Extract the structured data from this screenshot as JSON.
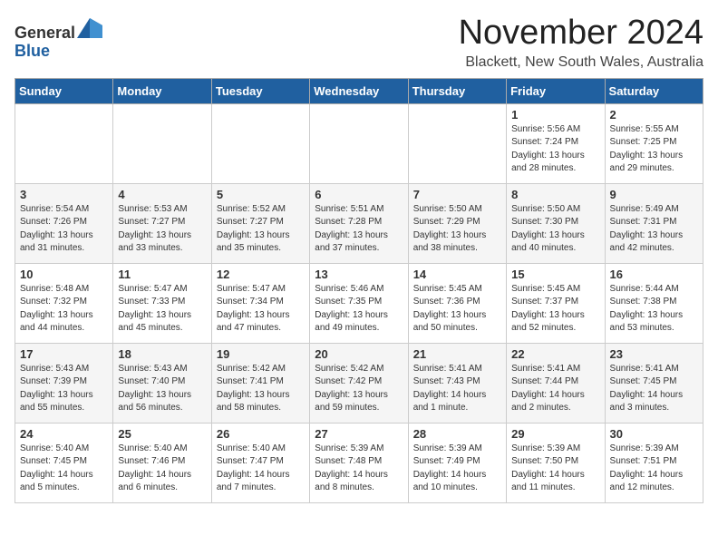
{
  "header": {
    "logo": {
      "general": "General",
      "blue": "Blue"
    },
    "title": "November 2024",
    "location": "Blackett, New South Wales, Australia"
  },
  "calendar": {
    "days_of_week": [
      "Sunday",
      "Monday",
      "Tuesday",
      "Wednesday",
      "Thursday",
      "Friday",
      "Saturday"
    ],
    "weeks": [
      [
        {
          "day": "",
          "info": ""
        },
        {
          "day": "",
          "info": ""
        },
        {
          "day": "",
          "info": ""
        },
        {
          "day": "",
          "info": ""
        },
        {
          "day": "",
          "info": ""
        },
        {
          "day": "1",
          "info": "Sunrise: 5:56 AM\nSunset: 7:24 PM\nDaylight: 13 hours\nand 28 minutes."
        },
        {
          "day": "2",
          "info": "Sunrise: 5:55 AM\nSunset: 7:25 PM\nDaylight: 13 hours\nand 29 minutes."
        }
      ],
      [
        {
          "day": "3",
          "info": "Sunrise: 5:54 AM\nSunset: 7:26 PM\nDaylight: 13 hours\nand 31 minutes."
        },
        {
          "day": "4",
          "info": "Sunrise: 5:53 AM\nSunset: 7:27 PM\nDaylight: 13 hours\nand 33 minutes."
        },
        {
          "day": "5",
          "info": "Sunrise: 5:52 AM\nSunset: 7:27 PM\nDaylight: 13 hours\nand 35 minutes."
        },
        {
          "day": "6",
          "info": "Sunrise: 5:51 AM\nSunset: 7:28 PM\nDaylight: 13 hours\nand 37 minutes."
        },
        {
          "day": "7",
          "info": "Sunrise: 5:50 AM\nSunset: 7:29 PM\nDaylight: 13 hours\nand 38 minutes."
        },
        {
          "day": "8",
          "info": "Sunrise: 5:50 AM\nSunset: 7:30 PM\nDaylight: 13 hours\nand 40 minutes."
        },
        {
          "day": "9",
          "info": "Sunrise: 5:49 AM\nSunset: 7:31 PM\nDaylight: 13 hours\nand 42 minutes."
        }
      ],
      [
        {
          "day": "10",
          "info": "Sunrise: 5:48 AM\nSunset: 7:32 PM\nDaylight: 13 hours\nand 44 minutes."
        },
        {
          "day": "11",
          "info": "Sunrise: 5:47 AM\nSunset: 7:33 PM\nDaylight: 13 hours\nand 45 minutes."
        },
        {
          "day": "12",
          "info": "Sunrise: 5:47 AM\nSunset: 7:34 PM\nDaylight: 13 hours\nand 47 minutes."
        },
        {
          "day": "13",
          "info": "Sunrise: 5:46 AM\nSunset: 7:35 PM\nDaylight: 13 hours\nand 49 minutes."
        },
        {
          "day": "14",
          "info": "Sunrise: 5:45 AM\nSunset: 7:36 PM\nDaylight: 13 hours\nand 50 minutes."
        },
        {
          "day": "15",
          "info": "Sunrise: 5:45 AM\nSunset: 7:37 PM\nDaylight: 13 hours\nand 52 minutes."
        },
        {
          "day": "16",
          "info": "Sunrise: 5:44 AM\nSunset: 7:38 PM\nDaylight: 13 hours\nand 53 minutes."
        }
      ],
      [
        {
          "day": "17",
          "info": "Sunrise: 5:43 AM\nSunset: 7:39 PM\nDaylight: 13 hours\nand 55 minutes."
        },
        {
          "day": "18",
          "info": "Sunrise: 5:43 AM\nSunset: 7:40 PM\nDaylight: 13 hours\nand 56 minutes."
        },
        {
          "day": "19",
          "info": "Sunrise: 5:42 AM\nSunset: 7:41 PM\nDaylight: 13 hours\nand 58 minutes."
        },
        {
          "day": "20",
          "info": "Sunrise: 5:42 AM\nSunset: 7:42 PM\nDaylight: 13 hours\nand 59 minutes."
        },
        {
          "day": "21",
          "info": "Sunrise: 5:41 AM\nSunset: 7:43 PM\nDaylight: 14 hours\nand 1 minute."
        },
        {
          "day": "22",
          "info": "Sunrise: 5:41 AM\nSunset: 7:44 PM\nDaylight: 14 hours\nand 2 minutes."
        },
        {
          "day": "23",
          "info": "Sunrise: 5:41 AM\nSunset: 7:45 PM\nDaylight: 14 hours\nand 3 minutes."
        }
      ],
      [
        {
          "day": "24",
          "info": "Sunrise: 5:40 AM\nSunset: 7:45 PM\nDaylight: 14 hours\nand 5 minutes."
        },
        {
          "day": "25",
          "info": "Sunrise: 5:40 AM\nSunset: 7:46 PM\nDaylight: 14 hours\nand 6 minutes."
        },
        {
          "day": "26",
          "info": "Sunrise: 5:40 AM\nSunset: 7:47 PM\nDaylight: 14 hours\nand 7 minutes."
        },
        {
          "day": "27",
          "info": "Sunrise: 5:39 AM\nSunset: 7:48 PM\nDaylight: 14 hours\nand 8 minutes."
        },
        {
          "day": "28",
          "info": "Sunrise: 5:39 AM\nSunset: 7:49 PM\nDaylight: 14 hours\nand 10 minutes."
        },
        {
          "day": "29",
          "info": "Sunrise: 5:39 AM\nSunset: 7:50 PM\nDaylight: 14 hours\nand 11 minutes."
        },
        {
          "day": "30",
          "info": "Sunrise: 5:39 AM\nSunset: 7:51 PM\nDaylight: 14 hours\nand 12 minutes."
        }
      ]
    ]
  }
}
